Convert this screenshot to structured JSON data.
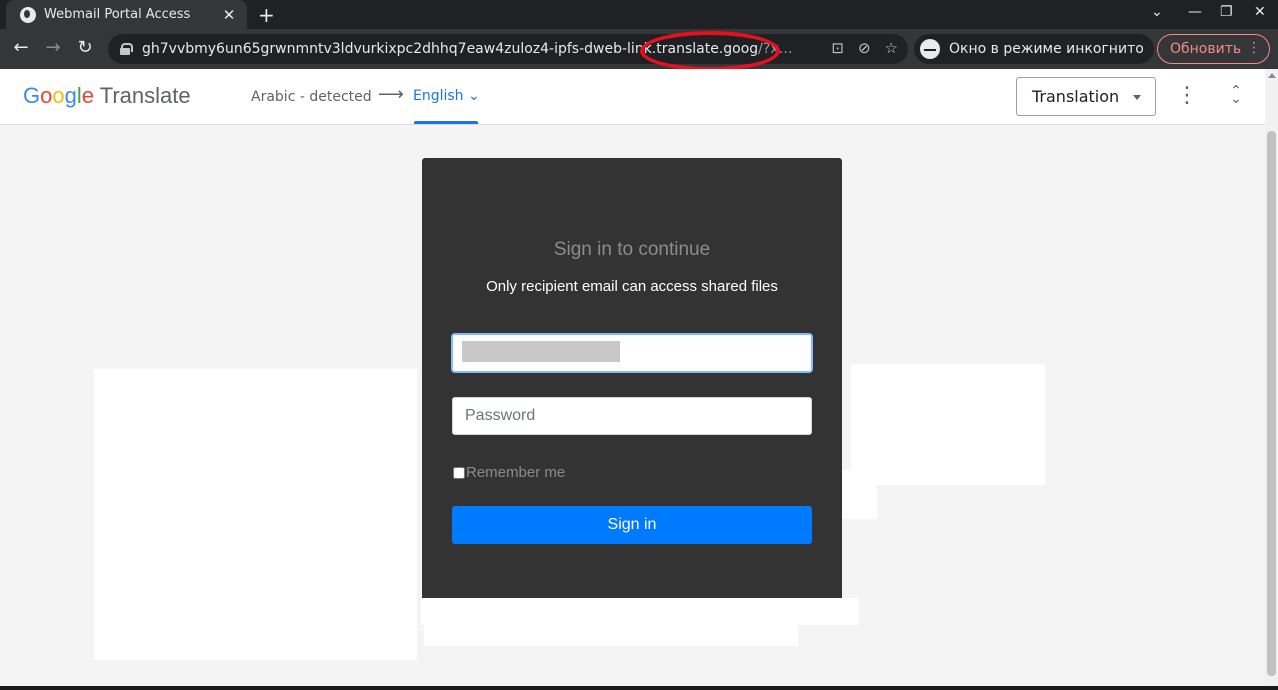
{
  "browser": {
    "tab_title": "Webmail Portal Access",
    "tab_close": "✕",
    "new_tab": "+",
    "window_controls": {
      "dropdown": "⌄",
      "minimize": "—",
      "maximize": "❐",
      "close": "✕"
    },
    "url_main": "gh7vvbmy6un65grwnmntv3ldvurkixpc2dhhq7eaw4zuloz4-ipfs-dweb-link.translate.goog",
    "url_rest": "/?x…",
    "incognito_label": "Окно в режиме инкогнито",
    "update_label": "Обновить",
    "icons": {
      "back": "←",
      "forward": "→",
      "reload": "↻",
      "translate": "⊡",
      "eye_off": "⊘",
      "star": "☆",
      "menu": "⋮"
    }
  },
  "translate_bar": {
    "logo_google": [
      "G",
      "o",
      "o",
      "g",
      "l",
      "e"
    ],
    "logo_translate": "Translate",
    "source_language": "Arabic - detected",
    "arrow": "⟶",
    "target_language": "English",
    "target_caret": "⌄",
    "mode_select": "Translation",
    "more": "⋮",
    "collapse": "⌄"
  },
  "login": {
    "title": "Sign in to continue",
    "subtitle": "Only recipient email can access shared files",
    "password_placeholder": "Password",
    "remember_label": "Remember me",
    "signin_label": "Sign in"
  },
  "colors": {
    "card": "#333333",
    "primary_button": "#007bff",
    "translate_accent": "#1a73e8",
    "highlight_circle": "#e8101e"
  }
}
